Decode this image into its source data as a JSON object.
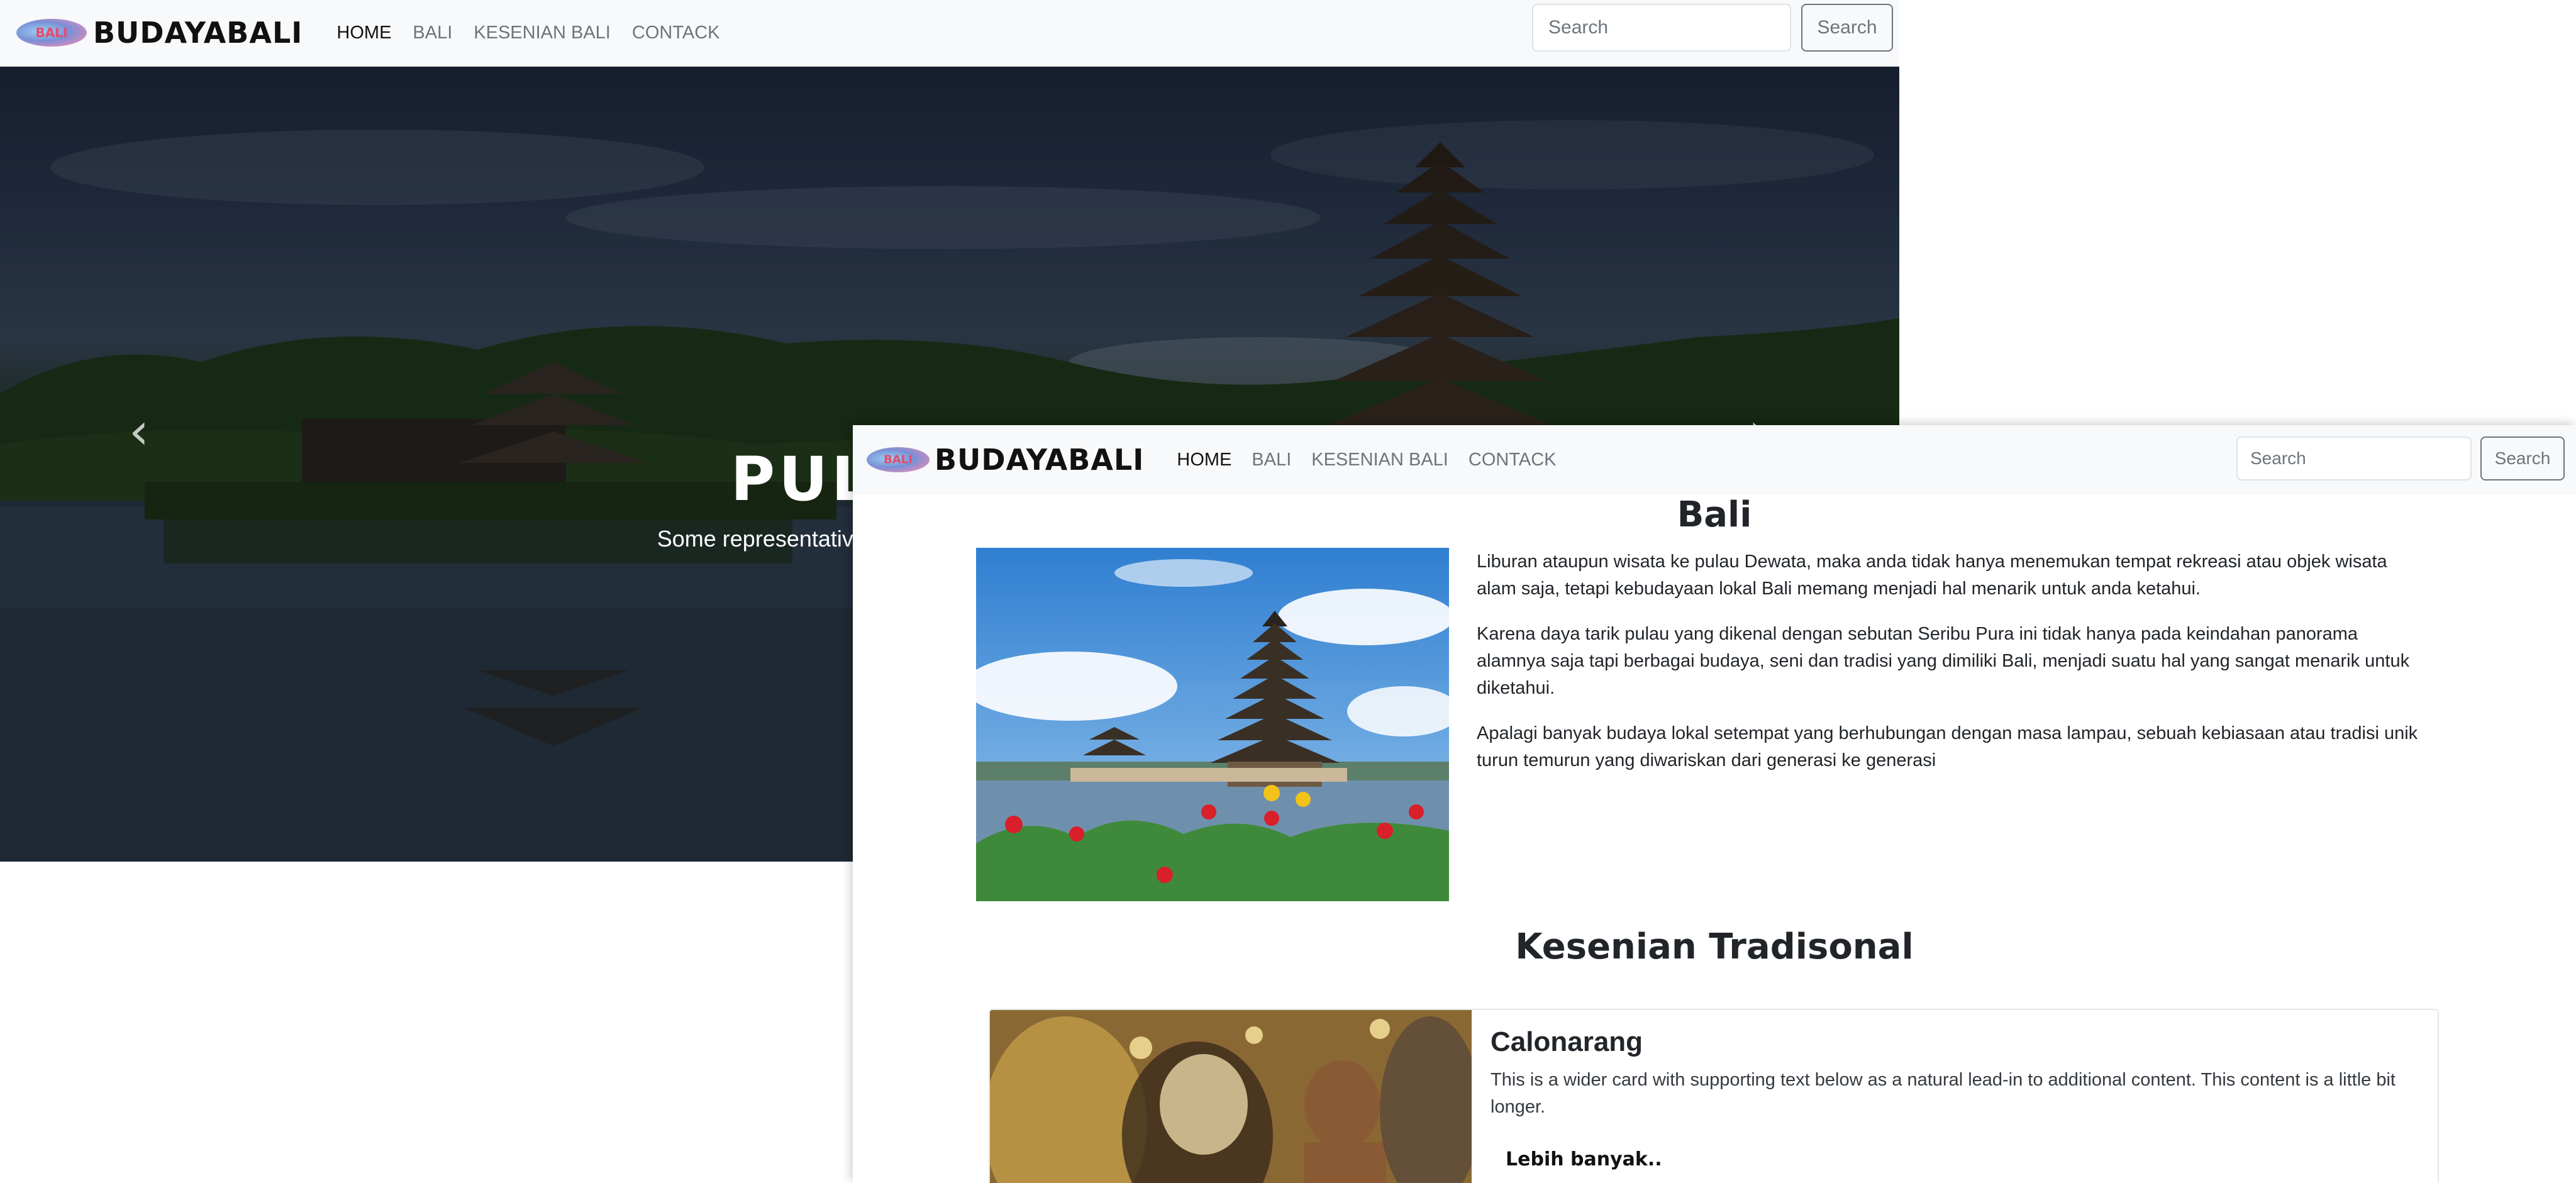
{
  "brand": {
    "logo_text": "BALI",
    "name": "BUDAYABALI"
  },
  "nav": {
    "items": [
      {
        "label": "HOME",
        "active": true
      },
      {
        "label": "BALI",
        "active": false
      },
      {
        "label": "KESENIAN BALI",
        "active": false
      },
      {
        "label": "CONTACK",
        "active": false
      }
    ]
  },
  "search": {
    "placeholder": "Search",
    "button_label": "Search"
  },
  "hero": {
    "title": "PULAU BALI",
    "subtitle": "Some representative placeholder content for the first slide.",
    "prev_icon": "chevron-left-icon",
    "next_icon": "chevron-right-icon"
  },
  "bali": {
    "title": "Bali",
    "paragraphs": [
      "Liburan ataupun wisata ke pulau Dewata, maka anda tidak hanya menemukan tempat rekreasi atau objek wisata alam saja, tetapi kebudayaan lokal Bali memang menjadi hal menarik untuk anda ketahui.",
      "Karena daya tarik pulau yang dikenal dengan sebutan Seribu Pura ini tidak hanya pada keindahan panorama alamnya saja tapi berbagai budaya, seni dan tradisi yang dimiliki Bali, menjadi suatu hal yang sangat menarik untuk diketahui.",
      "Apalagi banyak budaya lokal setempat yang berhubungan dengan masa lampau, sebuah kebiasaan atau tradisi unik turun temurun yang diwariskan dari generasi ke generasi"
    ]
  },
  "kesenian": {
    "title": "Kesenian Tradisonal",
    "card": {
      "title": "Calonarang",
      "text": "This is a wider card with supporting text below as a natural lead-in to additional content. This content is a little bit longer.",
      "link_label": "Lebih banyak.."
    }
  },
  "colors": {
    "navbar_bg": "#f8f9fa",
    "active_link": "#111111",
    "muted_link": "#6c757d"
  }
}
